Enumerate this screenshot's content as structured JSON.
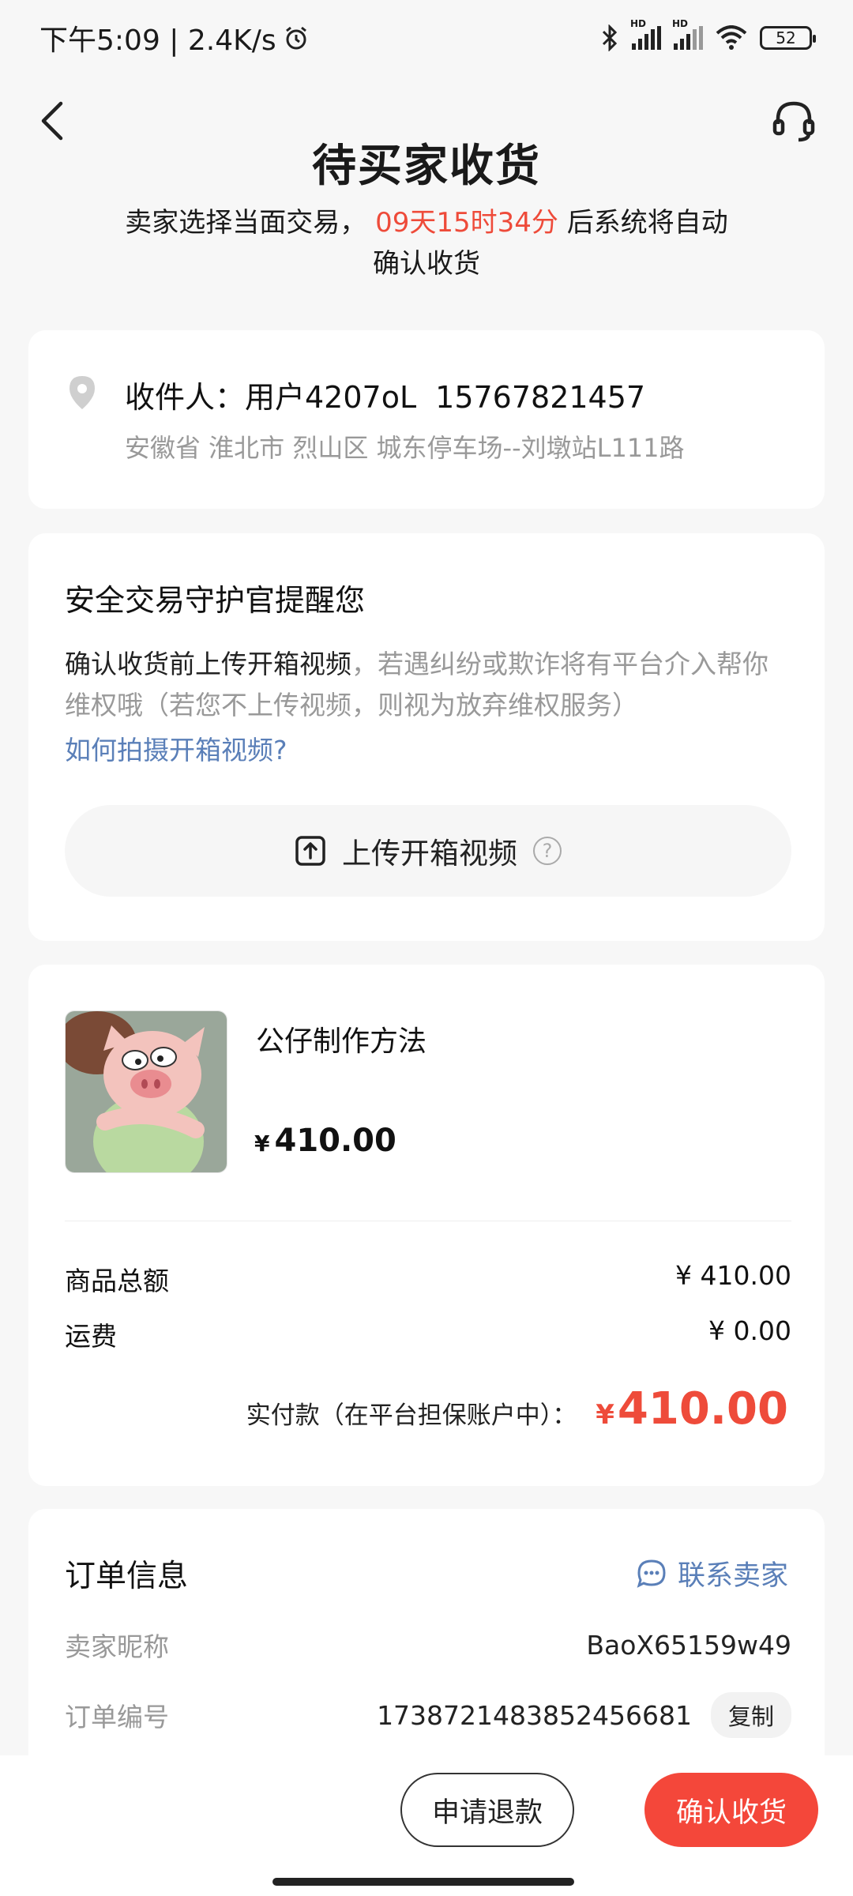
{
  "status_bar": {
    "time_speed": "下午5:09 | 2.4K/s",
    "battery": "52",
    "hd": "HD"
  },
  "header": {
    "title": "待买家收货",
    "subtitle_prefix": "卖家选择当面交易，",
    "countdown": "09天15时34分",
    "subtitle_suffix": "后系统将自动确认收货"
  },
  "address": {
    "receiver_label": "收件人：用户4207oL",
    "phone": "15767821457",
    "detail": "安徽省 淮北市 烈山区 城东停车场--刘墩站L111路"
  },
  "safety": {
    "title": "安全交易守护官提醒您",
    "text_dark": "确认收货前上传开箱视频",
    "text_gray": "，若遇纠纷或欺诈将有平台介入帮你维权哦（若您不上传视频，则视为放弃维权服务）",
    "link": "如何拍摄开箱视频?",
    "upload_label": "上传开箱视频",
    "help_glyph": "?"
  },
  "goods": {
    "name": "公仔制作方法",
    "currency": "¥",
    "price": "410.00",
    "subtotal_label": "商品总额",
    "subtotal_value": "¥ 410.00",
    "shipping_label": "运费",
    "shipping_value": "¥ 0.00",
    "paid_label": "实付款（在平台担保账户中）：",
    "paid_currency": "¥",
    "paid_value": "410.00"
  },
  "order": {
    "title": "订单信息",
    "contact_seller": "联系卖家",
    "seller_nick_label": "卖家昵称",
    "seller_nick_value": "BaoX65159w49",
    "order_no_label": "订单编号",
    "order_no_value": "1738721483852456681",
    "copy_label": "复制"
  },
  "actions": {
    "refund": "申请退款",
    "confirm": "确认收货"
  },
  "colors": {
    "accent_red": "#ee4b3a",
    "link_blue": "#5a7fb8"
  }
}
